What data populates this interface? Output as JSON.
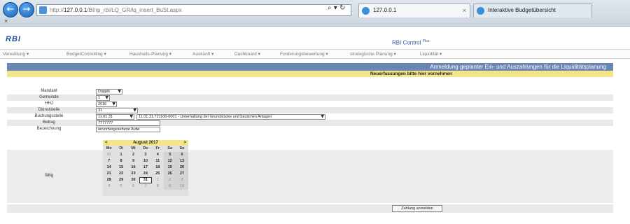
{
  "browser": {
    "url_prefix": "http://",
    "url_host": "127.0.0.1",
    "url_path": "/BI/rp_rbi/LQ_GR/lq_insert_BuSt.aspx",
    "search_actions": "⌕ ▾ ↻",
    "tabs": [
      {
        "label": "127.0.0.1"
      },
      {
        "label": "Interaktive Budgetübersicht"
      }
    ],
    "tab_close": "×",
    "close_label": "×"
  },
  "app": {
    "logo": "RBI",
    "title": "RBI Control",
    "title_sup": "Plus"
  },
  "menu": [
    "Verwaltung ▾",
    "BudgetControlling ▾",
    "Haushalts-Planung ▾",
    "Auskunft ▾",
    "Dashboard ▾",
    "Forderungsbewertung ▾",
    "strategische Planung ▾",
    "Liquidität ▾"
  ],
  "page": {
    "title": "Anmeldung geplanter Ein- und Auszahlungen für die Liquiditätsplanung",
    "subtitle": "Neuerfassungen bitte hier vornehmen"
  },
  "form": {
    "mandant_label": "Mandant",
    "mandant_value": "Doppik",
    "gemeinde_label": "Gemeinde",
    "gemeinde_value": "1",
    "hhj_label": "HHJ",
    "hhj_value": "2016",
    "dienststelle_label": "Dienststelle",
    "dienststelle_value": "31",
    "buchungsstelle_label": "Buchungsstelle",
    "buchungsstelle_value": "11.01.31",
    "buchungsstelle_desc": "11.01.31.721100-0001 - Unterhaltung der Grundstücke und baulichen Anlagen",
    "betrag_label": "Betrag",
    "betrag_value": "7777777",
    "bezeichnung_label": "Bezeichnung",
    "bezeichnung_value": "unvorhergesehene Aufw",
    "faellig_label": "fällig",
    "submit_label": "Zahlung anmelden"
  },
  "calendar": {
    "month": "August 2017",
    "prev": "<",
    "next": ">",
    "weekdays": [
      "Mo",
      "Di",
      "Mi",
      "Do",
      "Fr",
      "Sa",
      "So"
    ],
    "weeks": [
      [
        "31",
        "1",
        "2",
        "3",
        "4",
        "5",
        "6"
      ],
      [
        "7",
        "8",
        "9",
        "10",
        "11",
        "12",
        "13"
      ],
      [
        "14",
        "15",
        "16",
        "17",
        "18",
        "19",
        "20"
      ],
      [
        "21",
        "22",
        "23",
        "24",
        "25",
        "26",
        "27"
      ],
      [
        "28",
        "29",
        "30",
        "31",
        "1",
        "2",
        "3"
      ],
      [
        "4",
        "5",
        "6",
        "7",
        "8",
        "9",
        "10"
      ]
    ],
    "selected_day": "31"
  }
}
